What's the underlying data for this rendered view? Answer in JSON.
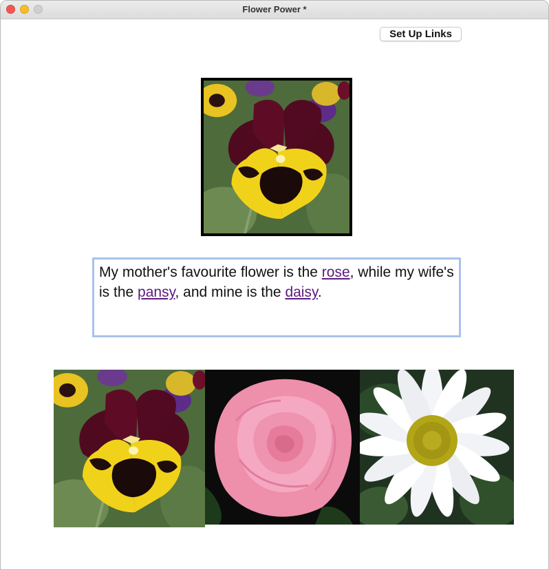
{
  "window": {
    "title": "Flower Power *"
  },
  "toolbar": {
    "setup_links_label": "Set Up Links"
  },
  "text": {
    "part1": "My mother's favourite flower is the ",
    "link_rose": "rose",
    "part2": ", while my wife's is the ",
    "link_pansy": "pansy",
    "part3": ", and mine is the ",
    "link_daisy": "daisy",
    "part4": "."
  },
  "images": {
    "main": "pansy",
    "thumbnails": [
      "pansy",
      "rose",
      "daisy"
    ]
  },
  "colors": {
    "link": "#5b1a7e",
    "focus_ring": "#a9c2ea",
    "pansy_petal": "#5a0b22",
    "pansy_yellow": "#f2d21a",
    "rose_pink": "#f19cb6",
    "daisy_center": "#b2a517"
  }
}
